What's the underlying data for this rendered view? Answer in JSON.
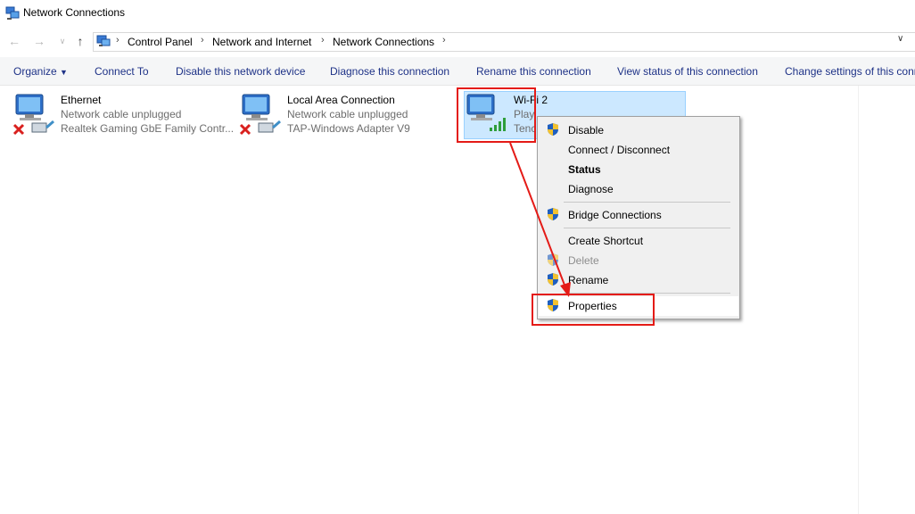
{
  "window": {
    "title": "Network Connections"
  },
  "address": {
    "crumbs": [
      "Control Panel",
      "Network and Internet",
      "Network Connections"
    ]
  },
  "toolbar": {
    "organize": "Organize",
    "connect_to": "Connect To",
    "disable_device": "Disable this network device",
    "diagnose": "Diagnose this connection",
    "rename": "Rename this connection",
    "view_status": "View status of this connection",
    "change_settings": "Change settings of this conn"
  },
  "connections": [
    {
      "name": "Ethernet",
      "status": "Network cable unplugged",
      "device": "Realtek Gaming GbE Family Contr..."
    },
    {
      "name": "Local Area Connection",
      "status": "Network cable unplugged",
      "device": "TAP-Windows Adapter V9"
    },
    {
      "name": "Wi-Fi 2",
      "status": "Play",
      "device": "Tenc"
    }
  ],
  "context_menu": {
    "disable": "Disable",
    "connect_disconnect": "Connect / Disconnect",
    "status": "Status",
    "diagnose": "Diagnose",
    "bridge": "Bridge Connections",
    "create_shortcut": "Create Shortcut",
    "delete": "Delete",
    "rename": "Rename",
    "properties": "Properties"
  },
  "colors": {
    "annotation_red": "#e41b17",
    "selection": "#cce8ff",
    "command_text": "#1e3287"
  }
}
